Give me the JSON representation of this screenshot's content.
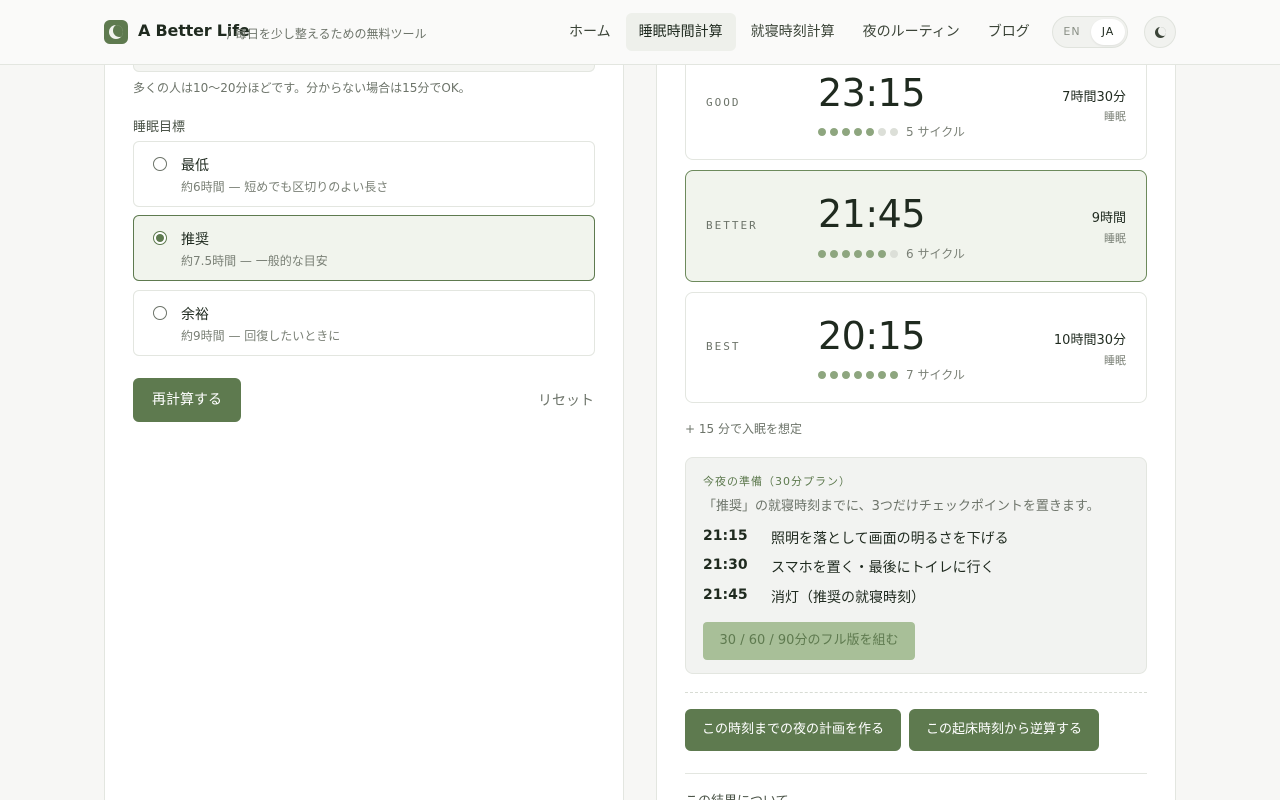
{
  "header": {
    "brand": "A Better Life",
    "tagline": "/ 毎日を少し整えるための無料ツール",
    "nav": [
      {
        "label": "ホーム"
      },
      {
        "label": "睡眠時間計算"
      },
      {
        "label": "就寝時刻計算"
      },
      {
        "label": "夜のルーティン"
      },
      {
        "label": "ブログ"
      }
    ],
    "active_nav": "睡眠時間計算",
    "lang": {
      "en": "EN",
      "ja": "JA",
      "selected": "JA"
    }
  },
  "form": {
    "hint": "多くの人は10〜20分ほどです。分からない場合は15分でOK。",
    "goal_label": "睡眠目標",
    "options": [
      {
        "title": "最低",
        "desc": "約6時間 — 短めでも区切りのよい長さ",
        "selected": false
      },
      {
        "title": "推奨",
        "desc": "約7.5時間 — 一般的な目安",
        "selected": true
      },
      {
        "title": "余裕",
        "desc": "約9時間 — 回復したいときに",
        "selected": false
      }
    ],
    "recalc_label": "再計算する",
    "reset_label": "リセット"
  },
  "results": [
    {
      "label": "GOOD",
      "time": "23:15",
      "cycles_filled": 5,
      "cycles_total": 7,
      "cycles_text": "5 サイクル",
      "duration": "7時間30分",
      "duration_sub": "睡眠",
      "featured": false
    },
    {
      "label": "BETTER",
      "time": "21:45",
      "cycles_filled": 6,
      "cycles_total": 7,
      "cycles_text": "6 サイクル",
      "duration": "9時間",
      "duration_sub": "睡眠",
      "featured": true
    },
    {
      "label": "BEST",
      "time": "20:15",
      "cycles_filled": 7,
      "cycles_total": 7,
      "cycles_text": "7 サイクル",
      "duration": "10時間30分",
      "duration_sub": "睡眠",
      "featured": false
    }
  ],
  "onset_note": "+ 15 分で入眠を想定",
  "plan": {
    "title": "今夜の準備（30分プラン）",
    "desc": "「推奨」の就寝時刻までに、3つだけチェックポイントを置きます。",
    "rows": [
      {
        "time": "21:15",
        "text": "照明を落として画面の明るさを下げる"
      },
      {
        "time": "21:30",
        "text": "スマホを置く・最後にトイレに行く"
      },
      {
        "time": "21:45",
        "text": "消灯（推奨の就寝時刻）"
      }
    ],
    "full_button": "30 / 60 / 90分のフル版を組む"
  },
  "actions": {
    "night_plan": "この時刻までの夜の計画を作る",
    "reverse": "この起床時刻から逆算する"
  },
  "about_heading": "この結果について",
  "colors": {
    "accent": "#5e7a4f",
    "accent_light": "#a8bf98",
    "selected_bg": "#f1f4ed"
  }
}
